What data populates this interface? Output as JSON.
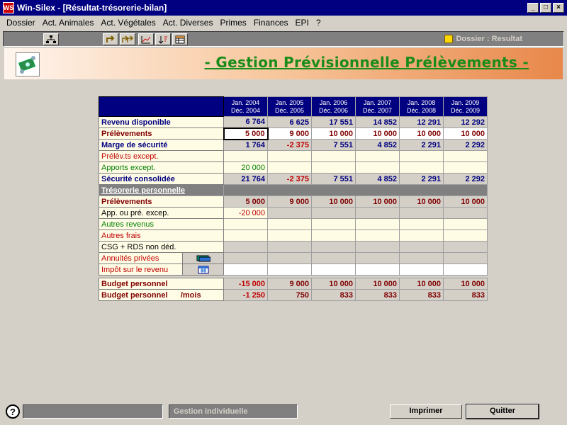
{
  "window": {
    "title": "Win-Silex - [Résultat-trésorerie-bilan]",
    "app_icon": "WS"
  },
  "menu": [
    "Dossier",
    "Act. Animales",
    "Act. Végétales",
    "Act. Diverses",
    "Primes",
    "Finances",
    "EPI",
    "?"
  ],
  "toolbar": {
    "status": "Dossier : Resultat"
  },
  "banner": {
    "title": "- Gestion Prévisionnelle Prélèvements -"
  },
  "years": [
    {
      "from": "Jan. 2004",
      "to": "Déc. 2004"
    },
    {
      "from": "Jan. 2005",
      "to": "Déc. 2005"
    },
    {
      "from": "Jan. 2006",
      "to": "Déc. 2006"
    },
    {
      "from": "Jan. 2007",
      "to": "Déc. 2007"
    },
    {
      "from": "Jan. 2008",
      "to": "Déc. 2008"
    },
    {
      "from": "Jan. 2009",
      "to": "Déc. 2009"
    }
  ],
  "rows": [
    {
      "label": "Revenu disponible",
      "style": "navy",
      "cellstyle": "calc",
      "valcolor": "navy",
      "values": [
        "6 764",
        "6 625",
        "17 551",
        "14 852",
        "12 291",
        "12 292"
      ]
    },
    {
      "label": "Prélèvements",
      "style": "maroon",
      "cellstyle": "white",
      "valcolor": "maroon",
      "values": [
        "5 000",
        "9 000",
        "10 000",
        "10 000",
        "10 000",
        "10 000"
      ]
    },
    {
      "label": "Marge de sécurité",
      "style": "navy",
      "cellstyle": "calc",
      "valcolor": "navy",
      "values": [
        "1 764",
        "-2 375",
        "7 551",
        "4 852",
        "2 291",
        "2 292"
      ]
    },
    {
      "label": "Prélèv.ts except.",
      "style": "red",
      "cellstyle": "input",
      "valcolor": "red",
      "values": [
        "",
        "",
        "",
        "",
        "",
        ""
      ]
    },
    {
      "label": "Apports except.",
      "style": "green",
      "cellstyle": "input",
      "valcolor": "green",
      "values": [
        "20 000",
        "",
        "",
        "",
        "",
        ""
      ]
    },
    {
      "label": "Sécurité consolidée",
      "style": "navy",
      "cellstyle": "calc",
      "valcolor": "navy",
      "values": [
        "21 764",
        "-2 375",
        "7 551",
        "4 852",
        "2 291",
        "2 292"
      ]
    },
    {
      "label": "Trésorerie personnelle",
      "style": "section",
      "cellstyle": "dark",
      "values": []
    },
    {
      "label": "Prélèvements",
      "style": "maroon",
      "cellstyle": "calc",
      "valcolor": "maroon",
      "values": [
        "5 000",
        "9 000",
        "10 000",
        "10 000",
        "10 000",
        "10 000"
      ]
    },
    {
      "label": "App. ou pré. excep.",
      "style": "black",
      "cellstyle": "calc",
      "valcolor": "red",
      "values": [
        "-20 000",
        "",
        "",
        "",
        "",
        ""
      ]
    },
    {
      "label": "Autres revenus",
      "style": "green",
      "cellstyle": "input",
      "valcolor": "green",
      "values": [
        "",
        "",
        "",
        "",
        "",
        ""
      ]
    },
    {
      "label": "Autres frais",
      "style": "red",
      "cellstyle": "input",
      "valcolor": "red",
      "values": [
        "",
        "",
        "",
        "",
        "",
        ""
      ]
    },
    {
      "label": "CSG + RDS non déd.",
      "style": "black",
      "cellstyle": "calc",
      "valcolor": "black",
      "values": [
        "",
        "",
        "",
        "",
        "",
        ""
      ]
    },
    {
      "label": "Annuités privées",
      "style": "red",
      "cellstyle": "calc",
      "valcolor": "red",
      "button": "annuities-icon",
      "values": [
        "",
        "",
        "",
        "",
        "",
        ""
      ]
    },
    {
      "label": "Impôt sur le revenu",
      "style": "red",
      "cellstyle": "white",
      "valcolor": "red",
      "button": "calendar-icon",
      "values": [
        "",
        "",
        "",
        "",
        "",
        ""
      ]
    },
    {
      "label": "",
      "style": "spacer",
      "cellstyle": "spacer",
      "values": []
    },
    {
      "label": "Budget personnel",
      "style": "maroon",
      "cellstyle": "calc",
      "valcolor": "maroon",
      "values": [
        "-15 000",
        "9 000",
        "10 000",
        "10 000",
        "10 000",
        "10 000"
      ]
    },
    {
      "label": "Budget personnel      /mois",
      "style": "maroon",
      "cellstyle": "calc",
      "valcolor": "maroon",
      "values": [
        "-1 250",
        "750",
        "833",
        "833",
        "833",
        "833"
      ]
    }
  ],
  "status": {
    "module": "Gestion individuelle",
    "help": "?"
  },
  "buttons": {
    "print": "Imprimer",
    "quit": "Quitter"
  }
}
